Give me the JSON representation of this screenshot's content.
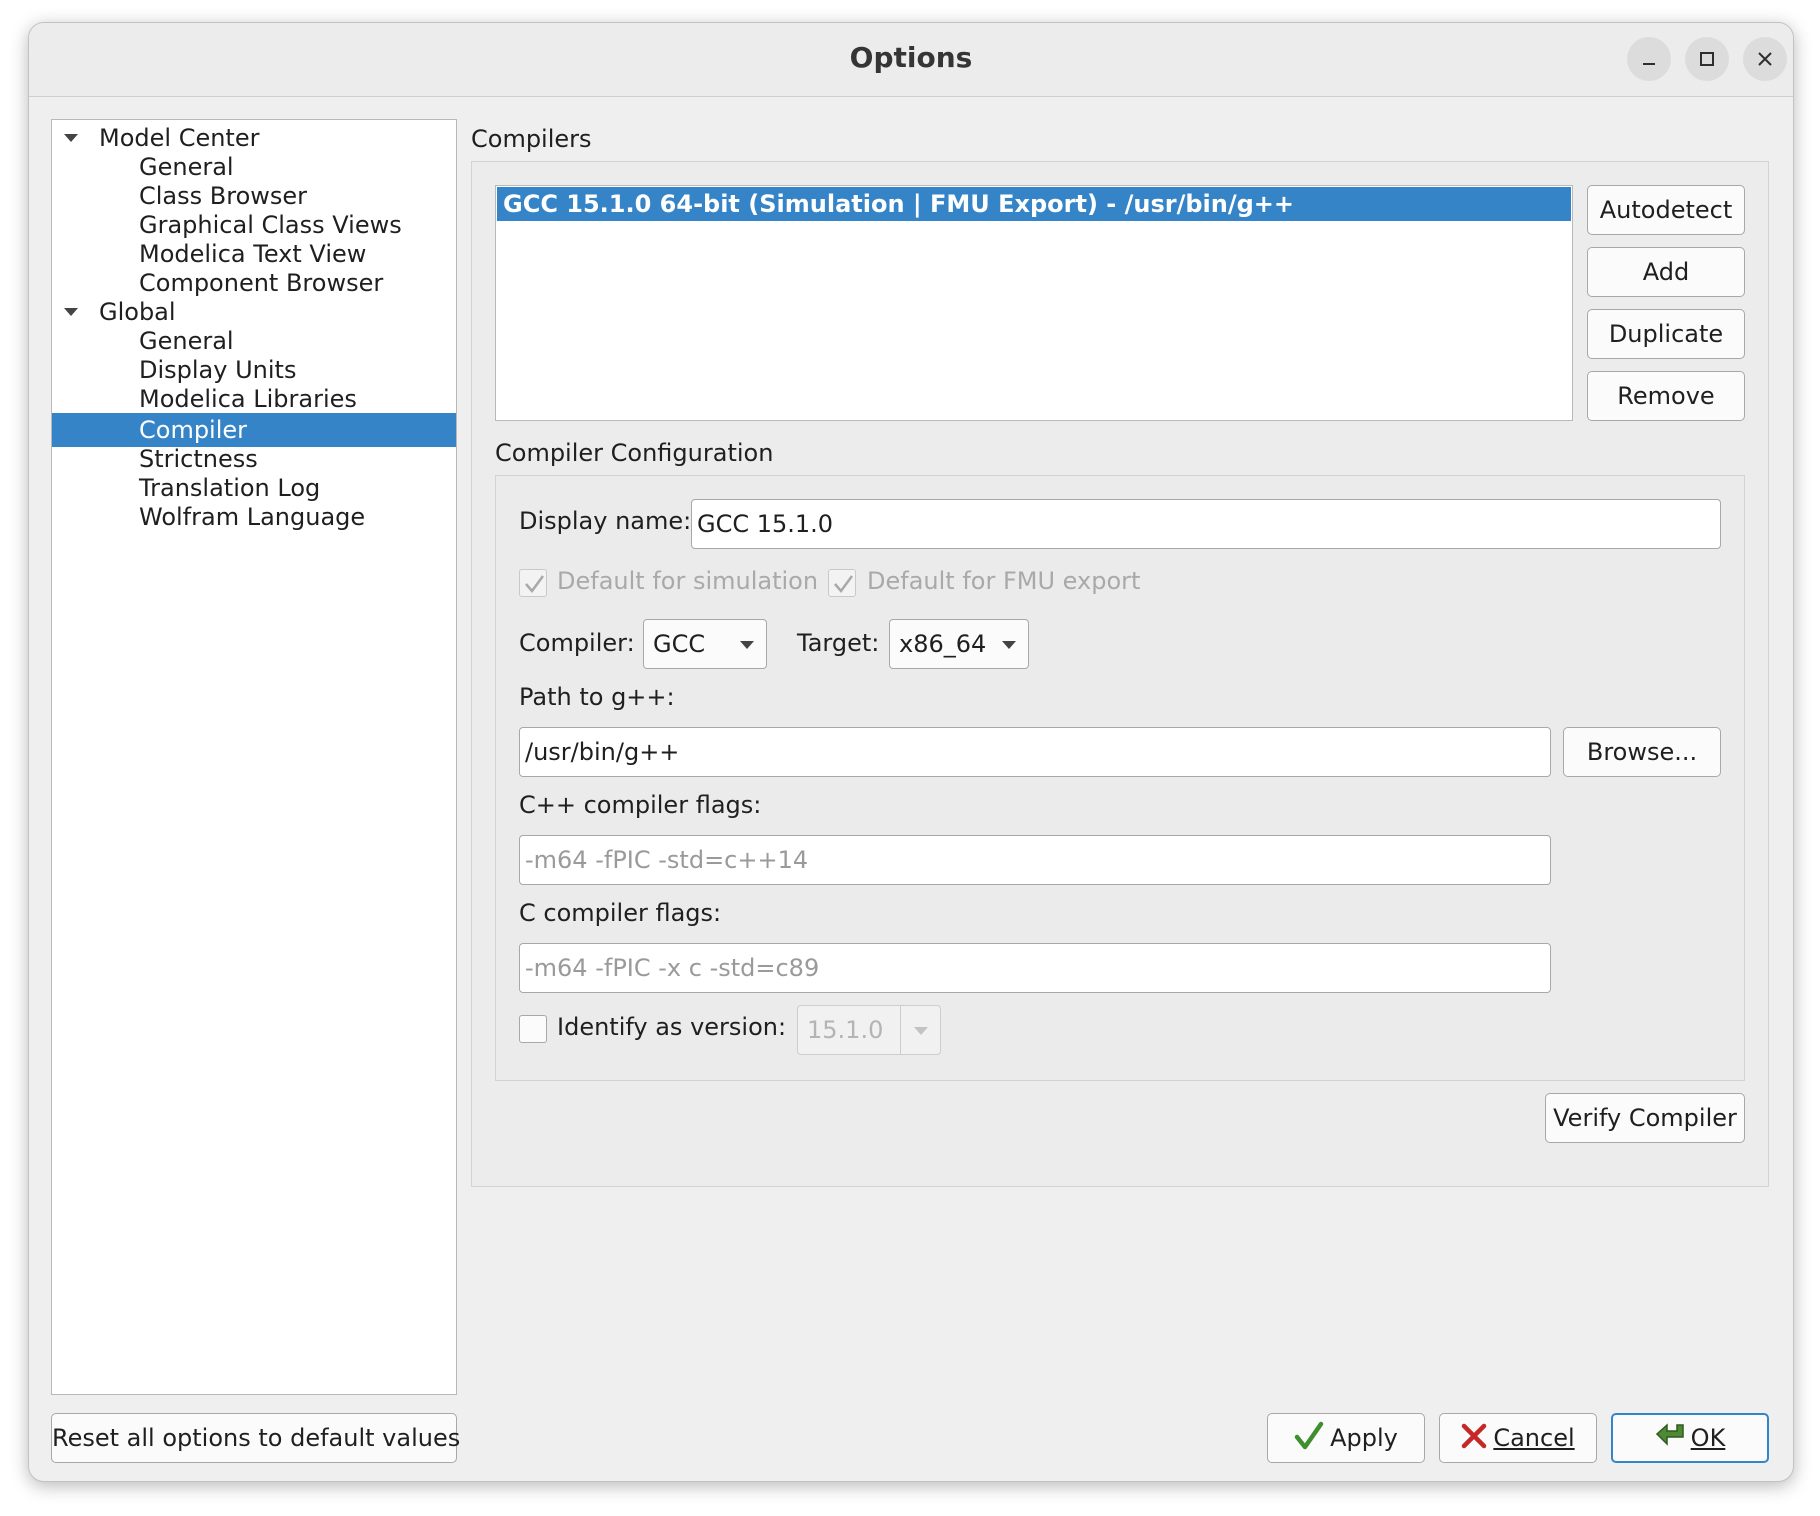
{
  "window": {
    "title": "Options"
  },
  "tree": {
    "items": [
      {
        "label": "Model Center",
        "level": 0,
        "expanded": true
      },
      {
        "label": "General",
        "level": 1
      },
      {
        "label": "Class Browser",
        "level": 1
      },
      {
        "label": "Graphical Class Views",
        "level": 1
      },
      {
        "label": "Modelica Text View",
        "level": 1
      },
      {
        "label": "Component Browser",
        "level": 1
      },
      {
        "label": "Global",
        "level": 0,
        "expanded": true
      },
      {
        "label": "General",
        "level": 1
      },
      {
        "label": "Display Units",
        "level": 1
      },
      {
        "label": "Modelica Libraries",
        "level": 1
      },
      {
        "label": "Compiler",
        "level": 1,
        "selected": true
      },
      {
        "label": "Strictness",
        "level": 1
      },
      {
        "label": "Translation Log",
        "level": 1
      },
      {
        "label": "Wolfram Language",
        "level": 1
      }
    ]
  },
  "compilers": {
    "section_label": "Compilers",
    "list": [
      "GCC 15.1.0 64-bit (Simulation | FMU Export) - /usr/bin/g++"
    ],
    "buttons": {
      "autodetect": "Autodetect",
      "add": "Add",
      "duplicate": "Duplicate",
      "remove": "Remove"
    }
  },
  "config": {
    "section_label": "Compiler Configuration",
    "display_name_label": "Display name:",
    "display_name_value": "GCC 15.1.0",
    "default_sim_label": "Default for simulation",
    "default_fmu_label": "Default for FMU export",
    "compiler_label": "Compiler:",
    "compiler_value": "GCC",
    "target_label": "Target:",
    "target_value": "x86_64",
    "path_label": "Path to g++:",
    "path_value": "/usr/bin/g++",
    "browse_label": "Browse...",
    "cpp_flags_label": "C++ compiler flags:",
    "cpp_flags_placeholder": "-m64 -fPIC -std=c++14",
    "c_flags_label": "C compiler flags:",
    "c_flags_placeholder": "-m64 -fPIC -x c -std=c89",
    "identify_label": "Identify as version:",
    "identify_value": "15.1.0",
    "verify_label": "Verify Compiler"
  },
  "footer": {
    "reset_label": "Reset all options to default values",
    "apply_label": "Apply",
    "cancel_label": "Cancel",
    "ok_label": "OK"
  },
  "colors": {
    "selection": "#3584c8",
    "window_bg": "#efefef"
  },
  "icons": [
    "minimize-icon",
    "maximize-icon",
    "close-icon",
    "expand-arrow-icon",
    "checkmark-icon",
    "green-check-icon",
    "red-x-icon",
    "ok-arrow-icon",
    "dropdown-caret-icon"
  ]
}
